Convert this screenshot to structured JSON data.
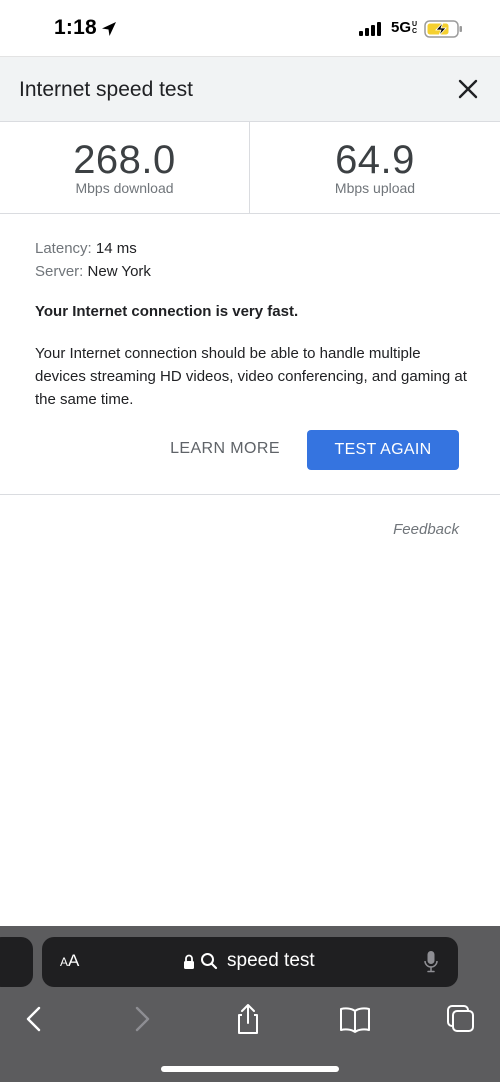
{
  "status_bar": {
    "time": "1:18",
    "network": "5G",
    "network_sup": "UC",
    "location_icon": "location-arrow-icon",
    "signal_icon": "cellular-signal-icon",
    "battery_icon": "battery-charging-icon",
    "battery_color": "#f5d02f"
  },
  "panel": {
    "title": "Internet speed test",
    "close_icon": "close-icon"
  },
  "results": {
    "download_value": "268.0",
    "download_label": "Mbps download",
    "upload_value": "64.9",
    "upload_label": "Mbps upload",
    "latency_label": "Latency:",
    "latency_value": "14 ms",
    "server_label": "Server:",
    "server_value": "New York",
    "headline": "Your Internet connection is very fast.",
    "description": "Your Internet connection should be able to handle multiple devices streaming HD videos, video conferencing, and gaming at the same time."
  },
  "actions": {
    "learn_more": "LEARN MORE",
    "test_again": "TEST AGAIN",
    "accent_color": "#3574e0"
  },
  "feedback": "Feedback",
  "browser": {
    "aa_big": "A",
    "aa_small": "A",
    "address_text": "speed test",
    "icons": [
      "lock-icon",
      "search-icon",
      "microphone-icon",
      "back-icon",
      "forward-icon",
      "share-icon",
      "bookmarks-icon",
      "tabs-icon"
    ]
  }
}
